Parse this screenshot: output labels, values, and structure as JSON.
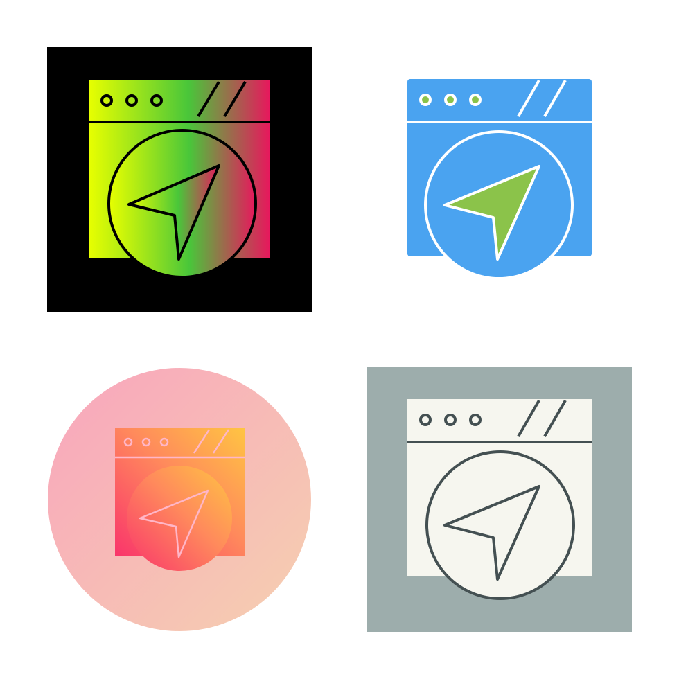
{
  "icon_set": {
    "subject": "browser-navigation-icon",
    "variants": [
      {
        "style": "gradient",
        "background_shape": "square",
        "background_color": "#000000",
        "gradient_colors": [
          "#e8ff00",
          "#49c63a",
          "#e8175d"
        ],
        "stroke_color": "#000000"
      },
      {
        "style": "flat",
        "background_shape": "none",
        "window_color": "#4aa3f0",
        "arrow_color": "#8bc34a",
        "stroke_color": "#ffffff"
      },
      {
        "style": "gradient-circle",
        "background_shape": "circle",
        "background_gradient": [
          "#f9a5bd",
          "#f5d0b0"
        ],
        "gradient_colors": [
          "#f9356b",
          "#ff8a5c",
          "#ffc542"
        ],
        "stroke_color": "#ffb6c8"
      },
      {
        "style": "glyph",
        "background_shape": "square",
        "background_color": "#9dadac",
        "window_color": "#f6f6ef",
        "stroke_color": "#445052"
      }
    ]
  }
}
